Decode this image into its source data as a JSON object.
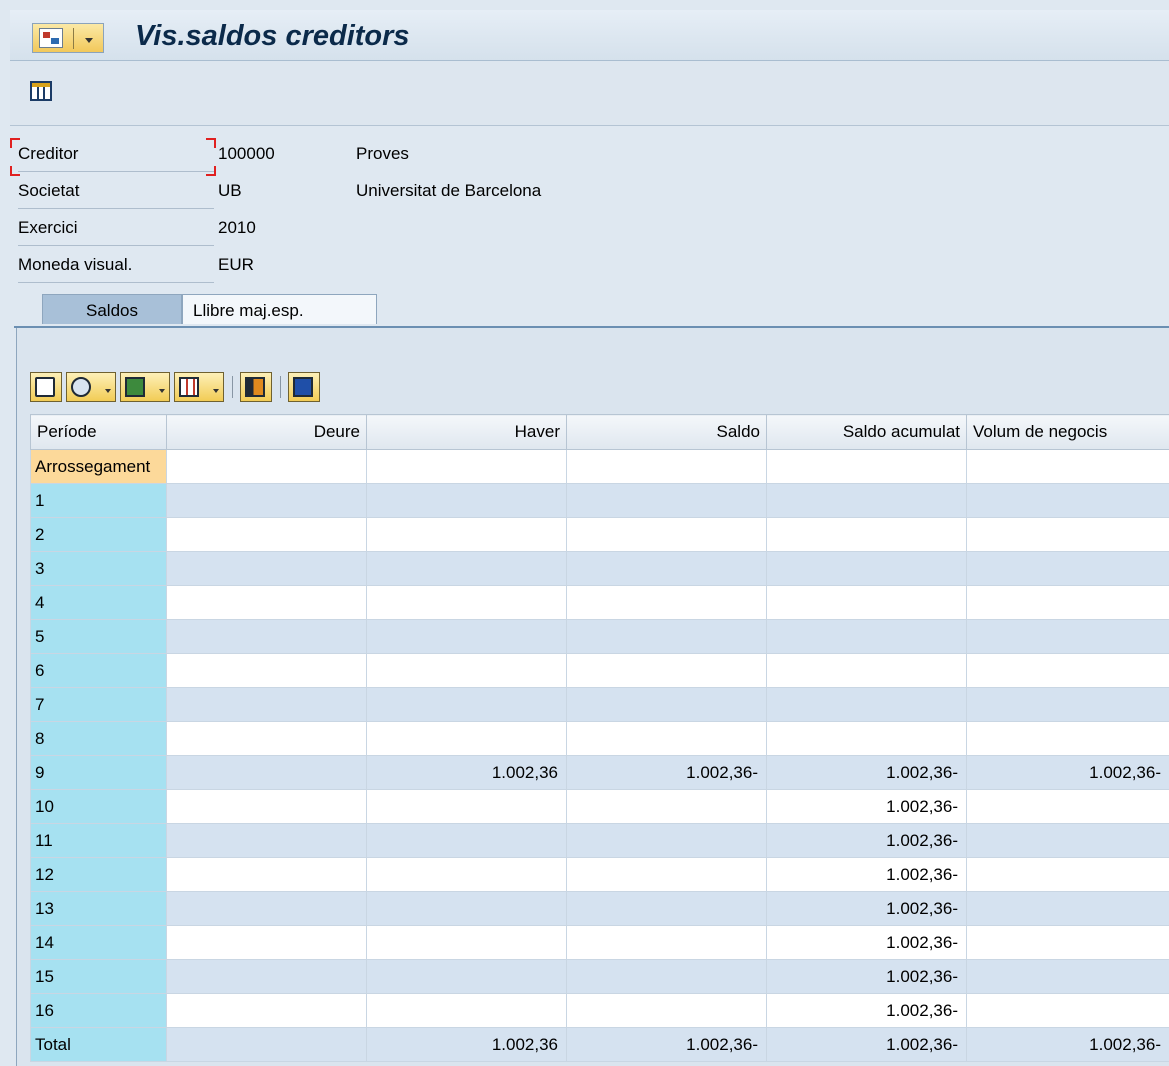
{
  "window": {
    "title": "Vis.saldos creditors"
  },
  "header": {
    "fields": [
      {
        "label": "Creditor",
        "value": "100000",
        "desc": "Proves"
      },
      {
        "label": "Societat",
        "value": "UB",
        "desc": "Universitat de Barcelona"
      },
      {
        "label": "Exercici",
        "value": "2010",
        "desc": ""
      },
      {
        "label": "Moneda visual.",
        "value": "EUR",
        "desc": ""
      }
    ]
  },
  "tabs": [
    {
      "label": "Saldos",
      "active": true
    },
    {
      "label": "Llibre maj.esp.",
      "active": false
    }
  ],
  "grid_toolbar": {
    "buttons": [
      "print-icon",
      "details-icon",
      "export-icon",
      "layout-icon",
      "graphic-icon",
      "info-icon"
    ]
  },
  "table": {
    "columns": [
      "Període",
      "Deure",
      "Haver",
      "Saldo",
      "Saldo acumulat",
      "Volum de negocis"
    ],
    "rows": [
      [
        "Arrossegament",
        "",
        "",
        "",
        "",
        ""
      ],
      [
        "1",
        "",
        "",
        "",
        "",
        ""
      ],
      [
        "2",
        "",
        "",
        "",
        "",
        ""
      ],
      [
        "3",
        "",
        "",
        "",
        "",
        ""
      ],
      [
        "4",
        "",
        "",
        "",
        "",
        ""
      ],
      [
        "5",
        "",
        "",
        "",
        "",
        ""
      ],
      [
        "6",
        "",
        "",
        "",
        "",
        ""
      ],
      [
        "7",
        "",
        "",
        "",
        "",
        ""
      ],
      [
        "8",
        "",
        "",
        "",
        "",
        ""
      ],
      [
        "9",
        "",
        "1.002,36",
        "1.002,36-",
        "1.002,36-",
        "1.002,36-"
      ],
      [
        "10",
        "",
        "",
        "",
        "1.002,36-",
        ""
      ],
      [
        "11",
        "",
        "",
        "",
        "1.002,36-",
        ""
      ],
      [
        "12",
        "",
        "",
        "",
        "1.002,36-",
        ""
      ],
      [
        "13",
        "",
        "",
        "",
        "1.002,36-",
        ""
      ],
      [
        "14",
        "",
        "",
        "",
        "1.002,36-",
        ""
      ],
      [
        "15",
        "",
        "",
        "",
        "1.002,36-",
        ""
      ],
      [
        "16",
        "",
        "",
        "",
        "1.002,36-",
        ""
      ],
      [
        "Total",
        "",
        "1.002,36",
        "1.002,36-",
        "1.002,36-",
        "1.002,36-"
      ]
    ]
  }
}
